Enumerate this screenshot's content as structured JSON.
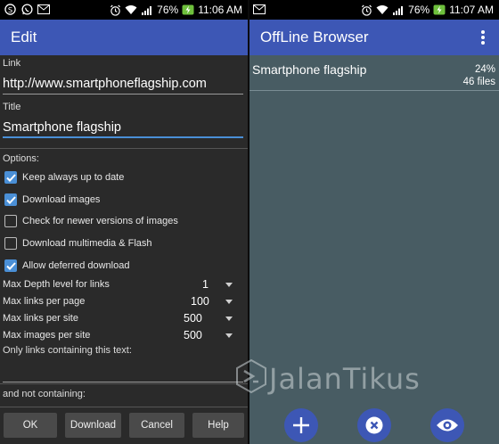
{
  "left": {
    "status": {
      "battery": "76%",
      "time": "11:06 AM"
    },
    "appbar_title": "Edit",
    "link_label": "Link",
    "link_value": "http://www.smartphoneflagship.com",
    "title_label": "Title",
    "title_value": "Smartphone flagship",
    "options_label": "Options:",
    "options": [
      {
        "label": "Keep always up to date",
        "checked": true
      },
      {
        "label": "Download images",
        "checked": true
      },
      {
        "label": "Check for newer versions of images",
        "checked": false
      },
      {
        "label": "Download multimedia & Flash",
        "checked": false
      },
      {
        "label": "Allow deferred download",
        "checked": true
      }
    ],
    "selects": [
      {
        "label": "Max Depth level for links",
        "value": "1"
      },
      {
        "label": "Max links per page",
        "value": "100"
      },
      {
        "label": "Max links per site",
        "value": "500"
      },
      {
        "label": "Max images per site",
        "value": "500"
      }
    ],
    "only_links_label": "Only links containing this text:",
    "not_containing_label": "and not containing:",
    "buttons": {
      "ok": "OK",
      "download": "Download",
      "cancel": "Cancel",
      "help": "Help"
    }
  },
  "right": {
    "status": {
      "battery": "76%",
      "time": "11:07 AM"
    },
    "appbar_title": "OffLine Browser",
    "items": [
      {
        "title": "Smartphone flagship",
        "progress": "24%",
        "files": "46 files"
      }
    ],
    "watermark": "JalanTikus"
  },
  "colors": {
    "accent": "#3d57b5",
    "checkbox": "#4a8fd6",
    "list_bg": "#485c63",
    "form_bg": "#2a2a2a"
  }
}
